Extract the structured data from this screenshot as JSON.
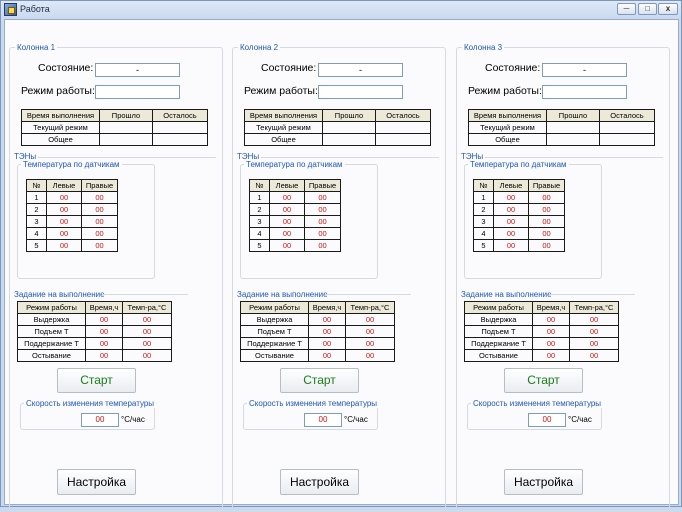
{
  "window": {
    "title": "Работа",
    "controls": {
      "minimize": "─",
      "maximize": "□",
      "close": "x"
    }
  },
  "columns": [
    {
      "label": "Колонна 1",
      "state_label": "Состояние:",
      "state_value": "-",
      "mode_label": "Режим работы:",
      "mode_value": "",
      "time_table": {
        "headers": [
          "Время выполнения",
          "Прошло",
          "Осталось"
        ],
        "rows": [
          [
            "Текущий режим",
            "",
            ""
          ],
          [
            "Общее",
            "",
            ""
          ]
        ]
      },
      "heaters_label": "ТЭНы",
      "sensor_group_label": "Температура по датчикам",
      "sensor_table": {
        "headers": [
          "№",
          "Левые",
          "Правые"
        ],
        "rows": [
          [
            "1",
            "00",
            "00"
          ],
          [
            "2",
            "00",
            "00"
          ],
          [
            "3",
            "00",
            "00"
          ],
          [
            "4",
            "00",
            "00"
          ],
          [
            "5",
            "00",
            "00"
          ]
        ]
      },
      "task_label": "Задание на выполнение",
      "task_table": {
        "headers": [
          "Режим работы",
          "Время,ч",
          "Темп-ра,°С"
        ],
        "rows": [
          [
            "Выдержка",
            "00",
            "00"
          ],
          [
            "Подъем Т",
            "00",
            "00"
          ],
          [
            "Поддержание Т",
            "00",
            "00"
          ],
          [
            "Остывание",
            "00",
            "00"
          ]
        ]
      },
      "start_label": "Старт",
      "speed_group_label": "Скорость изменения температуры",
      "speed_value": "00",
      "speed_unit": "°С/час",
      "settings_label": "Настройка"
    },
    {
      "label": "Колонна 2",
      "state_label": "Состояние:",
      "state_value": "-",
      "mode_label": "Режим работы:",
      "mode_value": "",
      "time_table": {
        "headers": [
          "Время выполнения",
          "Прошло",
          "Осталось"
        ],
        "rows": [
          [
            "Текущий режим",
            "",
            ""
          ],
          [
            "Общее",
            "",
            ""
          ]
        ]
      },
      "heaters_label": "ТЭНы",
      "sensor_group_label": "Температура по датчикам",
      "sensor_table": {
        "headers": [
          "№",
          "Левые",
          "Правые"
        ],
        "rows": [
          [
            "1",
            "00",
            "00"
          ],
          [
            "2",
            "00",
            "00"
          ],
          [
            "3",
            "00",
            "00"
          ],
          [
            "4",
            "00",
            "00"
          ],
          [
            "5",
            "00",
            "00"
          ]
        ]
      },
      "task_label": "Задание на выполнение",
      "task_table": {
        "headers": [
          "Режим работы",
          "Время,ч",
          "Темп-ра,°С"
        ],
        "rows": [
          [
            "Выдержка",
            "00",
            "00"
          ],
          [
            "Подъем Т",
            "00",
            "00"
          ],
          [
            "Поддержание Т",
            "00",
            "00"
          ],
          [
            "Остывание",
            "00",
            "00"
          ]
        ]
      },
      "start_label": "Старт",
      "speed_group_label": "Скорость изменения температуры",
      "speed_value": "00",
      "speed_unit": "°С/час",
      "settings_label": "Настройка"
    },
    {
      "label": "Колонна 3",
      "state_label": "Состояние:",
      "state_value": "-",
      "mode_label": "Режим работы:",
      "mode_value": "",
      "time_table": {
        "headers": [
          "Время выполнения",
          "Прошло",
          "Осталось"
        ],
        "rows": [
          [
            "Текущий режим",
            "",
            ""
          ],
          [
            "Общее",
            "",
            ""
          ]
        ]
      },
      "heaters_label": "ТЭНы",
      "sensor_group_label": "Температура по датчикам",
      "sensor_table": {
        "headers": [
          "№",
          "Левые",
          "Правые"
        ],
        "rows": [
          [
            "1",
            "00",
            "00"
          ],
          [
            "2",
            "00",
            "00"
          ],
          [
            "3",
            "00",
            "00"
          ],
          [
            "4",
            "00",
            "00"
          ],
          [
            "5",
            "00",
            "00"
          ]
        ]
      },
      "task_label": "Задание на выполнение",
      "task_table": {
        "headers": [
          "Режим работы",
          "Время,ч",
          "Темп-ра,°С"
        ],
        "rows": [
          [
            "Выдержка",
            "00",
            "00"
          ],
          [
            "Подъем Т",
            "00",
            "00"
          ],
          [
            "Поддержание Т",
            "00",
            "00"
          ],
          [
            "Остывание",
            "00",
            "00"
          ]
        ]
      },
      "start_label": "Старт",
      "speed_group_label": "Скорость изменения температуры",
      "speed_value": "00",
      "speed_unit": "°С/час",
      "settings_label": "Настройка"
    }
  ],
  "colors": {
    "section_label": "#1f57b6",
    "value_red": "#d21414",
    "start_text": "#1a7d1a"
  }
}
